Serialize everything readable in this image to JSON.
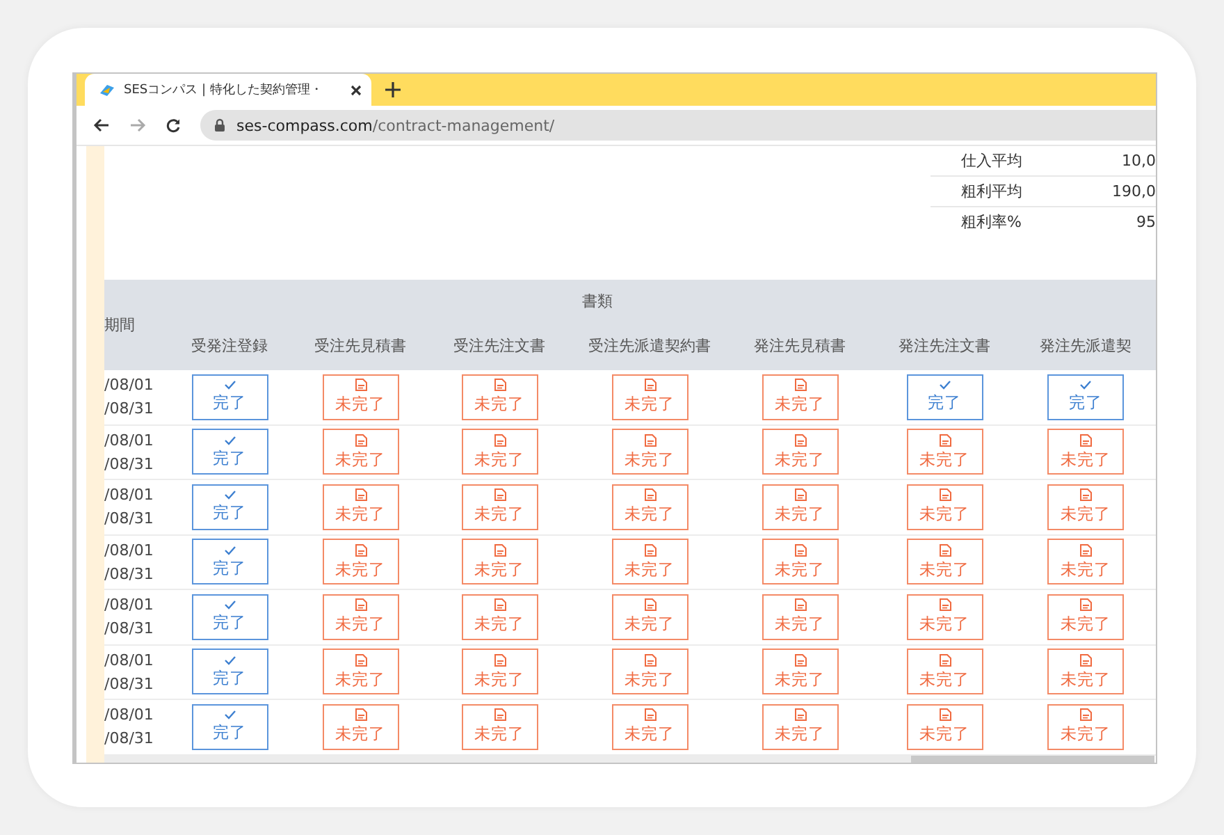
{
  "browser": {
    "tab_title": "SESコンパス | 特化した契約管理・",
    "url_host": "ses-compass.com",
    "url_path": "/contract-management/"
  },
  "summary": [
    {
      "label": "仕入平均",
      "value": "10,0"
    },
    {
      "label": "粗利平均",
      "value": "190,0"
    },
    {
      "label": "粗利率%",
      "value": "95"
    }
  ],
  "table": {
    "group_header": "書類",
    "columns": [
      "期間",
      "受発注登録",
      "受注先見積書",
      "受注先注文書",
      "受注先派遣契約書",
      "発注先見積書",
      "発注先注文書",
      "発注先派遣契"
    ],
    "rows": [
      {
        "period_start": "/08/01",
        "period_end": "/08/31",
        "documents": [
          {
            "label": "完了",
            "done": true
          },
          {
            "label": "未完了",
            "done": false
          },
          {
            "label": "未完了",
            "done": false
          },
          {
            "label": "未完了",
            "done": false
          },
          {
            "label": "未完了",
            "done": false
          },
          {
            "label": "完了",
            "done": true
          },
          {
            "label": "完了",
            "done": true
          }
        ]
      },
      {
        "period_start": "/08/01",
        "period_end": "/08/31",
        "documents": [
          {
            "label": "完了",
            "done": true
          },
          {
            "label": "未完了",
            "done": false
          },
          {
            "label": "未完了",
            "done": false
          },
          {
            "label": "未完了",
            "done": false
          },
          {
            "label": "未完了",
            "done": false
          },
          {
            "label": "未完了",
            "done": false
          },
          {
            "label": "未完了",
            "done": false
          }
        ]
      },
      {
        "period_start": "/08/01",
        "period_end": "/08/31",
        "documents": [
          {
            "label": "完了",
            "done": true
          },
          {
            "label": "未完了",
            "done": false
          },
          {
            "label": "未完了",
            "done": false
          },
          {
            "label": "未完了",
            "done": false
          },
          {
            "label": "未完了",
            "done": false
          },
          {
            "label": "未完了",
            "done": false
          },
          {
            "label": "未完了",
            "done": false
          }
        ]
      },
      {
        "period_start": "/08/01",
        "period_end": "/08/31",
        "documents": [
          {
            "label": "完了",
            "done": true
          },
          {
            "label": "未完了",
            "done": false
          },
          {
            "label": "未完了",
            "done": false
          },
          {
            "label": "未完了",
            "done": false
          },
          {
            "label": "未完了",
            "done": false
          },
          {
            "label": "未完了",
            "done": false
          },
          {
            "label": "未完了",
            "done": false
          }
        ]
      },
      {
        "period_start": "/08/01",
        "period_end": "/08/31",
        "documents": [
          {
            "label": "完了",
            "done": true
          },
          {
            "label": "未完了",
            "done": false
          },
          {
            "label": "未完了",
            "done": false
          },
          {
            "label": "未完了",
            "done": false
          },
          {
            "label": "未完了",
            "done": false
          },
          {
            "label": "未完了",
            "done": false
          },
          {
            "label": "未完了",
            "done": false
          }
        ]
      },
      {
        "period_start": "/08/01",
        "period_end": "/08/31",
        "documents": [
          {
            "label": "完了",
            "done": true
          },
          {
            "label": "未完了",
            "done": false
          },
          {
            "label": "未完了",
            "done": false
          },
          {
            "label": "未完了",
            "done": false
          },
          {
            "label": "未完了",
            "done": false
          },
          {
            "label": "未完了",
            "done": false
          },
          {
            "label": "未完了",
            "done": false
          }
        ]
      },
      {
        "period_start": "/08/01",
        "period_end": "/08/31",
        "documents": [
          {
            "label": "完了",
            "done": true
          },
          {
            "label": "未完了",
            "done": false
          },
          {
            "label": "未完了",
            "done": false
          },
          {
            "label": "未完了",
            "done": false
          },
          {
            "label": "未完了",
            "done": false
          },
          {
            "label": "未完了",
            "done": false
          },
          {
            "label": "未完了",
            "done": false
          }
        ]
      }
    ]
  }
}
